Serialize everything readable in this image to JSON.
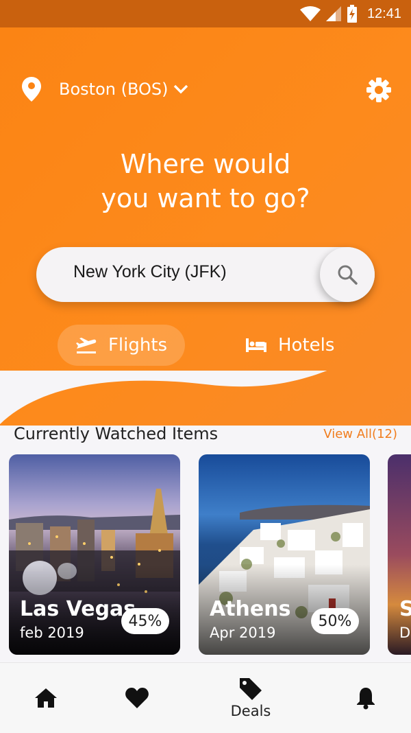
{
  "status_bar": {
    "time": "12:41"
  },
  "header": {
    "location_label": "Boston (BOS)",
    "headline_line1": "Where would",
    "headline_line2": "you want to go?"
  },
  "search": {
    "value": "New York City (JFK)"
  },
  "tabs": [
    {
      "label": "Flights",
      "selected": true
    },
    {
      "label": "Hotels",
      "selected": false
    }
  ],
  "watched": {
    "title": "Currently Watched Items",
    "view_all": "View All(12)",
    "cards": [
      {
        "name": "Las Vegas",
        "date": "feb 2019",
        "badge": "45%"
      },
      {
        "name": "Athens",
        "date": "Apr 2019",
        "badge": "50%"
      },
      {
        "name": "S",
        "date": "D"
      }
    ]
  },
  "bottom_nav": [
    {
      "icon": "home-icon"
    },
    {
      "icon": "heart-icon"
    },
    {
      "icon": "tag-icon",
      "label": "Deals",
      "selected": true
    },
    {
      "icon": "bell-icon"
    }
  ],
  "colors": {
    "accent": "#fb8414",
    "status_bar": "#c9610e",
    "link": "#f07c1c"
  }
}
